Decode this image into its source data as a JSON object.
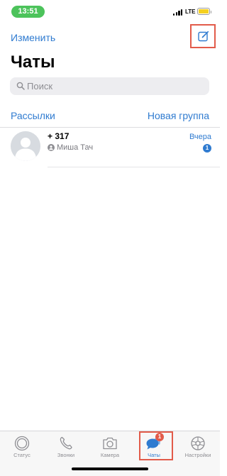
{
  "status_bar": {
    "time": "13:51",
    "network": "LTE",
    "accent_color": "#4cc35b",
    "battery_color": "#f5d020"
  },
  "header": {
    "edit_label": "Изменить",
    "compose_icon": "compose-icon",
    "title": "Чаты"
  },
  "search": {
    "placeholder": "Поиск",
    "value": ""
  },
  "links": {
    "broadcast_label": "Рассылки",
    "new_group_label": "Новая группа",
    "link_color": "#2f7bd0"
  },
  "chats": [
    {
      "name": "+                    317",
      "sender": "Миша Тач",
      "time": "Вчера",
      "unread": "1",
      "avatar": "default-avatar"
    }
  ],
  "tabs": [
    {
      "label": "Статус",
      "icon": "status-icon",
      "active": false
    },
    {
      "label": "Звонки",
      "icon": "phone-icon",
      "active": false
    },
    {
      "label": "Камера",
      "icon": "camera-icon",
      "active": false
    },
    {
      "label": "Чаты",
      "icon": "chats-icon",
      "active": true,
      "badge": "1"
    },
    {
      "label": "Настройки",
      "icon": "settings-icon",
      "active": false
    }
  ],
  "highlight_color": "#e25b4a"
}
